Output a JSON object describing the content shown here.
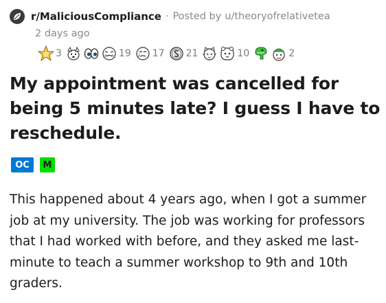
{
  "post": {
    "subreddit": "r/MaliciousCompliance",
    "separator": "·",
    "posted_by_prefix": "Posted by",
    "username": "u/theoryofrelativetea",
    "time_ago": "2 days ago",
    "title": "My appointment was cancelled for being 5 minutes late? I guess I have to reschedule.",
    "flairs": [
      {
        "label": "OC",
        "color": "#0079d3"
      },
      {
        "label": "M",
        "color": "#00dd00"
      }
    ],
    "body": "This happened about 4 years ago, when I got a summer job at my university. The job was working for professors that I had worked with before, and they asked me last-minute to teach a summer workshop to 9th and 10th graders."
  },
  "awards": [
    {
      "icon": "silver-star-award-icon",
      "count": "3"
    },
    {
      "icon": "dog-award-icon",
      "count": ""
    },
    {
      "icon": "eyes-award-icon",
      "count": ""
    },
    {
      "icon": "face-award-icon",
      "count": "19"
    },
    {
      "icon": "crying-face-award-icon",
      "count": "17"
    },
    {
      "icon": "coin-award-icon",
      "count": "21"
    },
    {
      "icon": "cat-award-icon",
      "count": ""
    },
    {
      "icon": "hamster-award-icon",
      "count": "10"
    },
    {
      "icon": "dino-award-icon",
      "count": ""
    },
    {
      "icon": "party-face-award-icon",
      "count": "2"
    }
  ],
  "colors": {
    "text": "#1c1c1c",
    "meta": "#878a8c",
    "oc_flair": "#0079d3",
    "mod_flair": "#00dd00"
  }
}
